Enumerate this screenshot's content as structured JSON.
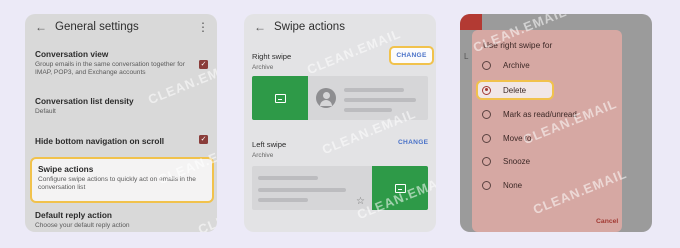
{
  "panel1": {
    "title": "General settings",
    "items": [
      {
        "title": "Conversation view",
        "subtitle": "Group emails in the same conversation together for IMAP, POP3, and Exchange accounts",
        "checked": true
      },
      {
        "title": "Conversation list density",
        "subtitle": "Default"
      },
      {
        "title": "Hide bottom navigation on scroll",
        "checked": true
      },
      {
        "title": "Swipe actions",
        "subtitle": "Configure swipe actions to quickly act on emails in the conversation list"
      },
      {
        "title": "Default reply action",
        "subtitle": "Choose your default reply action"
      }
    ]
  },
  "panel2": {
    "title": "Swipe actions",
    "right_swipe": {
      "label": "Right swipe",
      "value": "Archive",
      "button": "CHANGE"
    },
    "left_swipe": {
      "label": "Left swipe",
      "value": "Archive",
      "button": "CHANGE"
    }
  },
  "panel3": {
    "peek_letter": "L",
    "dialog_title": "Use right swipe for",
    "options": [
      "Archive",
      "Delete",
      "Mark as read/unread",
      "Move to",
      "Snooze",
      "None"
    ],
    "selected": "Delete",
    "cancel": "Cancel"
  },
  "watermark": "CLEAN.EMAIL",
  "icons": {
    "back": "back-arrow-icon",
    "more": "more-vert-icon",
    "check": "check-icon",
    "archive": "archive-icon",
    "star": "star-icon",
    "avatar": "avatar-icon"
  },
  "colors": {
    "background": "#eceaf7",
    "highlight_border": "#f1c24c",
    "accent_blue": "#4a72c8",
    "checkbox": "#8a3d3a",
    "swipe_green": "#2e9a48",
    "dialog_bg": "#d6a8a3",
    "radio_selected": "#a23a34"
  }
}
